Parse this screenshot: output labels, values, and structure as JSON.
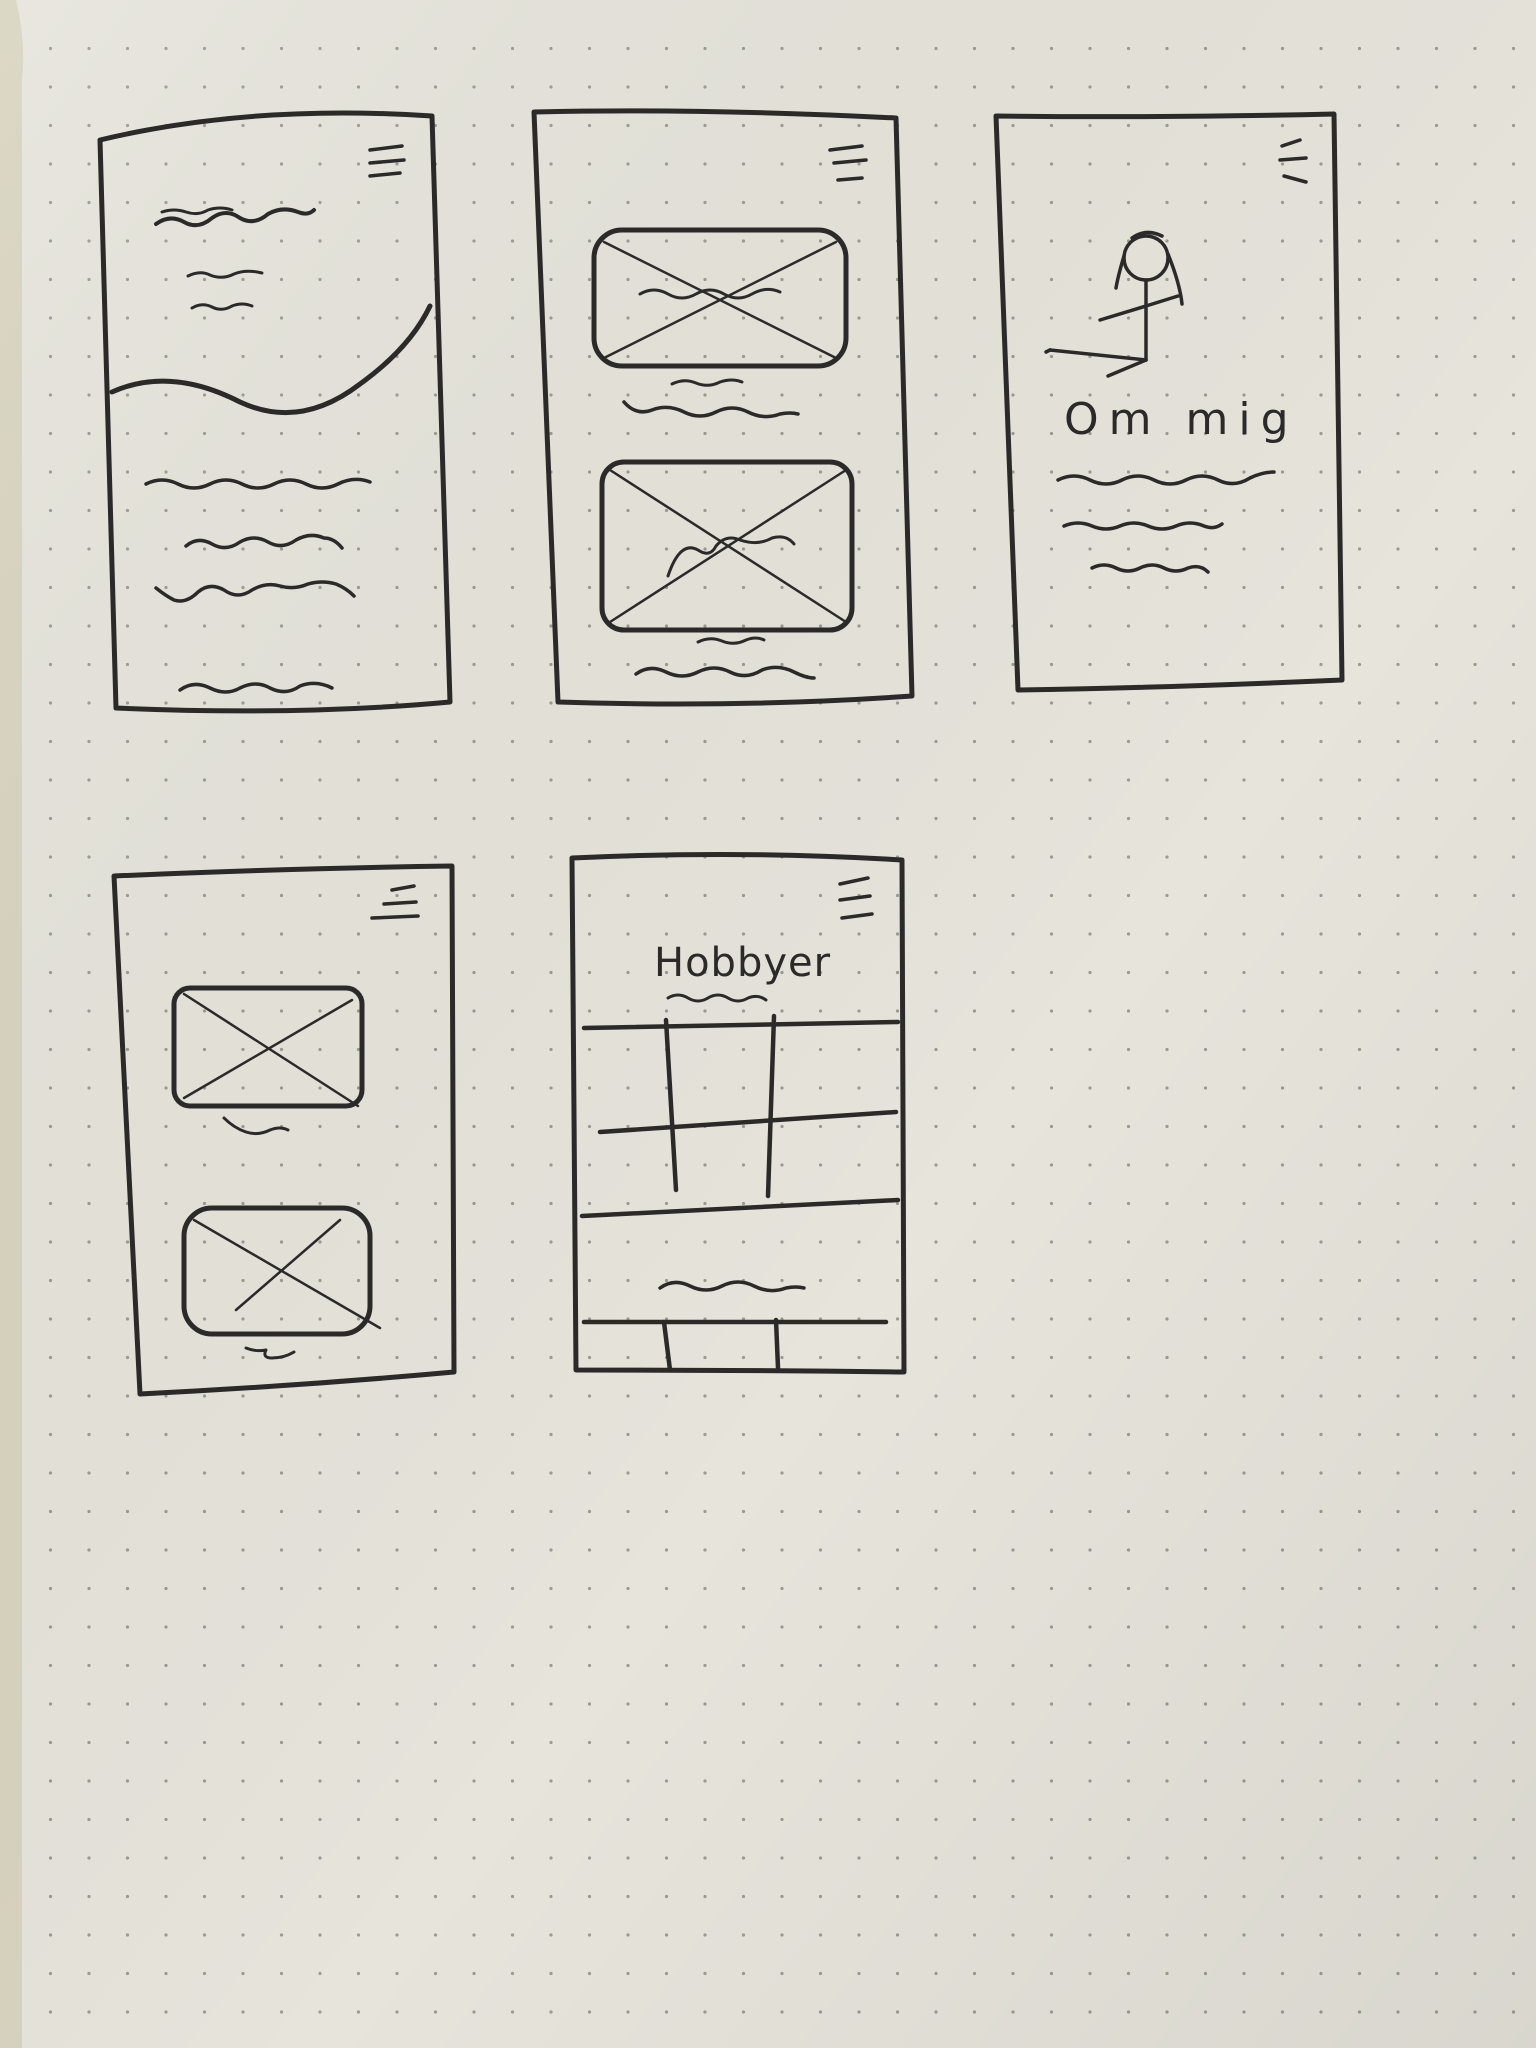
{
  "page": {
    "paper_color": "#e6e4db",
    "spine_color": "#d9d4c0",
    "dot_color": "#9b9a93",
    "ink_color": "#2b2a29"
  },
  "sketches": [
    {
      "screen": "home-wavy-hero-sketch",
      "menu_icon": "hamburger-icon"
    },
    {
      "screen": "image-list-sketch",
      "menu_icon": "hamburger-icon"
    },
    {
      "screen": "about-sketch",
      "menu_icon": "hamburger-icon",
      "heading": "Om mig"
    },
    {
      "screen": "gallery-sketch",
      "menu_icon": "hamburger-icon"
    },
    {
      "screen": "hobbies-grid-sketch",
      "menu_icon": "hamburger-icon",
      "heading": "Hobbyer"
    }
  ]
}
